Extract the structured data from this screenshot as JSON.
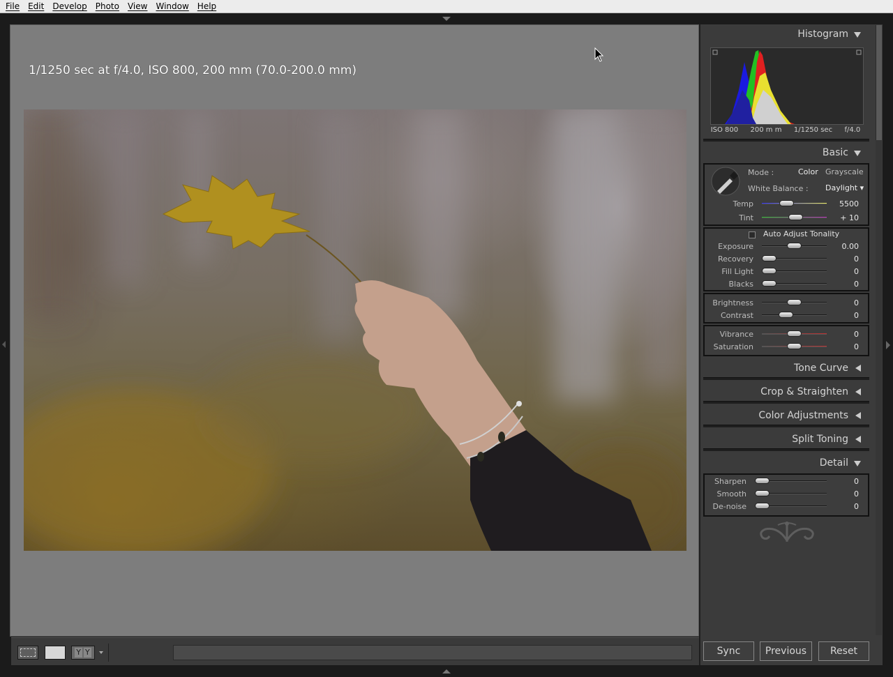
{
  "menu": [
    "File",
    "Edit",
    "Develop",
    "Photo",
    "View",
    "Window",
    "Help"
  ],
  "photo": {
    "exif": "1/1250 sec at f/4.0, ISO 800, 200 mm (70.0-200.0 mm)"
  },
  "histogram": {
    "title": "Histogram",
    "iso": "ISO 800",
    "focal": "200 m m",
    "shutter": "1/1250 sec",
    "aperture": "f/4.0"
  },
  "basic": {
    "title": "Basic",
    "mode_label": "Mode :",
    "mode_color": "Color",
    "mode_gray": "Grayscale",
    "wb_label": "White Balance :",
    "wb_value": "Daylight",
    "temp_label": "Temp",
    "temp_value": "5500",
    "tint_label": "Tint",
    "tint_value": "+ 10",
    "auto_label": "Auto Adjust Tonality",
    "exposure_label": "Exposure",
    "exposure_value": "0.00",
    "recovery_label": "Recovery",
    "recovery_value": "0",
    "filllight_label": "Fill Light",
    "filllight_value": "0",
    "blacks_label": "Blacks",
    "blacks_value": "0",
    "brightness_label": "Brightness",
    "brightness_value": "0",
    "contrast_label": "Contrast",
    "contrast_value": "0",
    "vibrance_label": "Vibrance",
    "vibrance_value": "0",
    "saturation_label": "Saturation",
    "saturation_value": "0"
  },
  "sections": {
    "tone_curve": "Tone Curve",
    "crop": "Crop & Straighten",
    "color_adj": "Color Adjustments",
    "split": "Split Toning",
    "detail": "Detail"
  },
  "detail": {
    "sharpen_label": "Sharpen",
    "sharpen_value": "0",
    "smooth_label": "Smooth",
    "smooth_value": "0",
    "denoise_label": "De-noise",
    "denoise_value": "0"
  },
  "buttons": {
    "sync": "Sync",
    "previous": "Previous",
    "reset": "Reset"
  },
  "toolbar": {
    "yy_left": "Y",
    "yy_right": "Y"
  }
}
